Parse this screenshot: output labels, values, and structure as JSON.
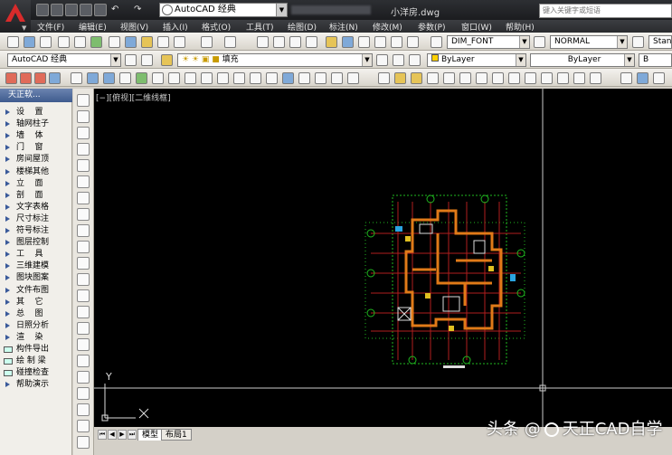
{
  "title_bar": {
    "workspace": "AutoCAD 经典",
    "document": "小洋房.dwg",
    "search_placeholder": "键入关键字或短语"
  },
  "menu": [
    "文件(F)",
    "编辑(E)",
    "视图(V)",
    "插入(I)",
    "格式(O)",
    "工具(T)",
    "绘图(D)",
    "标注(N)",
    "修改(M)",
    "参数(P)",
    "窗口(W)",
    "帮助(H)"
  ],
  "toolbar2": {
    "dim_style": "DIM_FONT",
    "text_style": "NORMAL",
    "table_style": "Standa"
  },
  "toolbar3": {
    "workspace": "AutoCAD 经典",
    "layer": "填充",
    "color": "ByLayer",
    "linetype": "ByLayer",
    "lineweight": "B"
  },
  "tianzheng": {
    "header": "天正软...",
    "items": [
      {
        "label": "设    置",
        "type": "tri"
      },
      {
        "label": "轴网柱子",
        "type": "tri"
      },
      {
        "label": "墙    体",
        "type": "tri"
      },
      {
        "label": "门    窗",
        "type": "tri"
      },
      {
        "label": "房间屋顶",
        "type": "tri"
      },
      {
        "label": "楼梯其他",
        "type": "tri"
      },
      {
        "label": "立    面",
        "type": "tri"
      },
      {
        "label": "剖    面",
        "type": "tri"
      },
      {
        "label": "文字表格",
        "type": "tri"
      },
      {
        "label": "尺寸标注",
        "type": "tri"
      },
      {
        "label": "符号标注",
        "type": "tri"
      },
      {
        "label": "图层控制",
        "type": "tri"
      },
      {
        "label": "工    具",
        "type": "tri"
      },
      {
        "label": "三维建模",
        "type": "tri"
      },
      {
        "label": "图块图案",
        "type": "tri"
      },
      {
        "label": "文件布图",
        "type": "tri"
      },
      {
        "label": "其    它",
        "type": "tri"
      },
      {
        "label": "总    图",
        "type": "tri"
      },
      {
        "label": "日照分析",
        "type": "tri"
      },
      {
        "label": "渲    染",
        "type": "tri"
      },
      {
        "label": "构件导出",
        "type": "icon"
      },
      {
        "label": "绘 制 梁",
        "type": "icon"
      },
      {
        "label": "碰撞检查",
        "type": "icon"
      },
      {
        "label": "帮助演示",
        "type": "tri"
      }
    ]
  },
  "viewport_label": "[−][俯视][二维线框]",
  "ucs_y": "Y",
  "tabs": [
    "模型",
    "布局1"
  ],
  "watermark": {
    "prefix": "头条 @",
    "name": "天正CAD自学"
  }
}
